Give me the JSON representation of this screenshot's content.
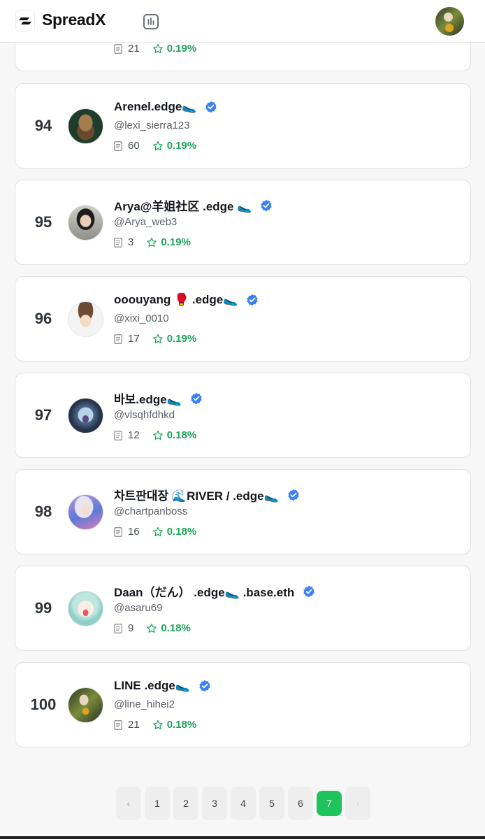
{
  "app": {
    "title": "SpreadX"
  },
  "colors": {
    "accent": "#1fc35c",
    "percent": "#1fa35a",
    "verified": "#3b82f6"
  },
  "entries": [
    {
      "rank": "",
      "name": "",
      "handle": "",
      "posts": "21",
      "percent": "0.19%",
      "avatar": "avatar-dark-partial"
    },
    {
      "rank": "94",
      "name": "Arenel.edge🥿",
      "handle": "@lexi_sierra123",
      "posts": "60",
      "percent": "0.19%",
      "avatar": "meerkat"
    },
    {
      "rank": "95",
      "name": "Arya@羊姐社区 .edge 🥿",
      "handle": "@Arya_web3",
      "posts": "3",
      "percent": "0.19%",
      "avatar": "woman-portrait"
    },
    {
      "rank": "96",
      "name": "ooouyang 🥊 .edge🥿",
      "handle": "@xixi_0010",
      "posts": "17",
      "percent": "0.19%",
      "avatar": "cartoon-boy"
    },
    {
      "rank": "97",
      "name": "바보.edge🥿",
      "handle": "@vlsqhfdhkd",
      "posts": "12",
      "percent": "0.18%",
      "avatar": "portal-figure"
    },
    {
      "rank": "98",
      "name": "차트판대장 🌊RIVER / .edge🥿",
      "handle": "@chartpanboss",
      "posts": "16",
      "percent": "0.18%",
      "avatar": "anime-girl"
    },
    {
      "rank": "99",
      "name": "Daan（だん） .edge🥿 .base.eth",
      "handle": "@asaru69",
      "posts": "9",
      "percent": "0.18%",
      "avatar": "crying-cartoon"
    },
    {
      "rank": "100",
      "name": "LINE .edge🥿",
      "handle": "@line_hihei2",
      "posts": "21",
      "percent": "0.18%",
      "avatar": "man-gold-coin"
    }
  ],
  "pagination": {
    "prev": "‹",
    "pages": [
      "1",
      "2",
      "3",
      "4",
      "5",
      "6",
      "7"
    ],
    "current": "7",
    "next": "›"
  }
}
